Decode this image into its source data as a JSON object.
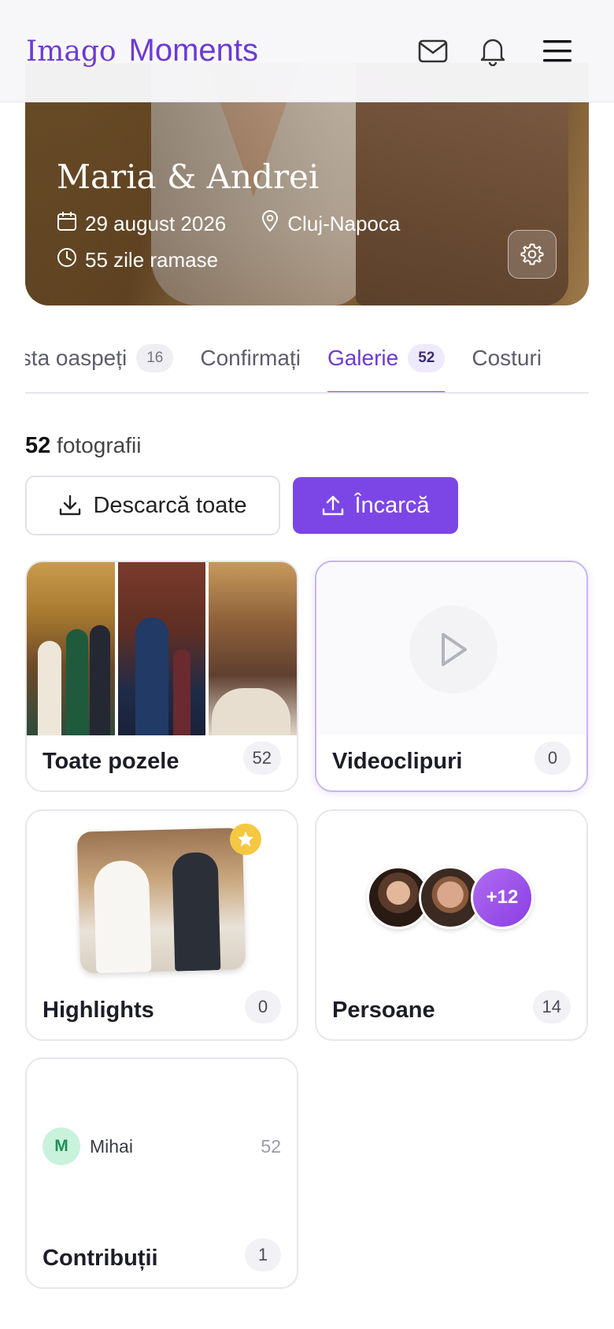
{
  "header": {
    "brand_part1": "Imago",
    "brand_part2": "Moments",
    "icons": [
      "mail-icon",
      "bell-icon",
      "menu-icon"
    ]
  },
  "event": {
    "title": "Maria & Andrei",
    "date": "29 august 2026",
    "location": "Cluj-Napoca",
    "days_left": "55 zile ramase"
  },
  "tabs": [
    {
      "label": "Lista oaspeți",
      "badge": "16"
    },
    {
      "label": "Confirmați",
      "badge": ""
    },
    {
      "label": "Galerie",
      "badge": "52"
    },
    {
      "label": "Costuri",
      "badge": ""
    }
  ],
  "active_tab": "Galerie",
  "gallery": {
    "count_number": "52",
    "count_label": "fotografii",
    "download_label": "Descarcă toate",
    "upload_label": "Încarcă"
  },
  "albums": [
    {
      "label": "Toate pozele",
      "count": "52"
    },
    {
      "label": "Videoclipuri",
      "count": "0"
    },
    {
      "label": "Highlights",
      "count": "0"
    },
    {
      "label": "Persoane",
      "count": "14"
    },
    {
      "label": "Contribuții",
      "count": "1"
    }
  ],
  "people_more": "+12",
  "contributor": {
    "initial": "M",
    "name": "Mihai",
    "count": "52"
  },
  "colors": {
    "accent": "#7c46e6",
    "brand": "#6d3ad4",
    "star": "#f5c842",
    "contributor_bg": "#c9f2dc"
  }
}
